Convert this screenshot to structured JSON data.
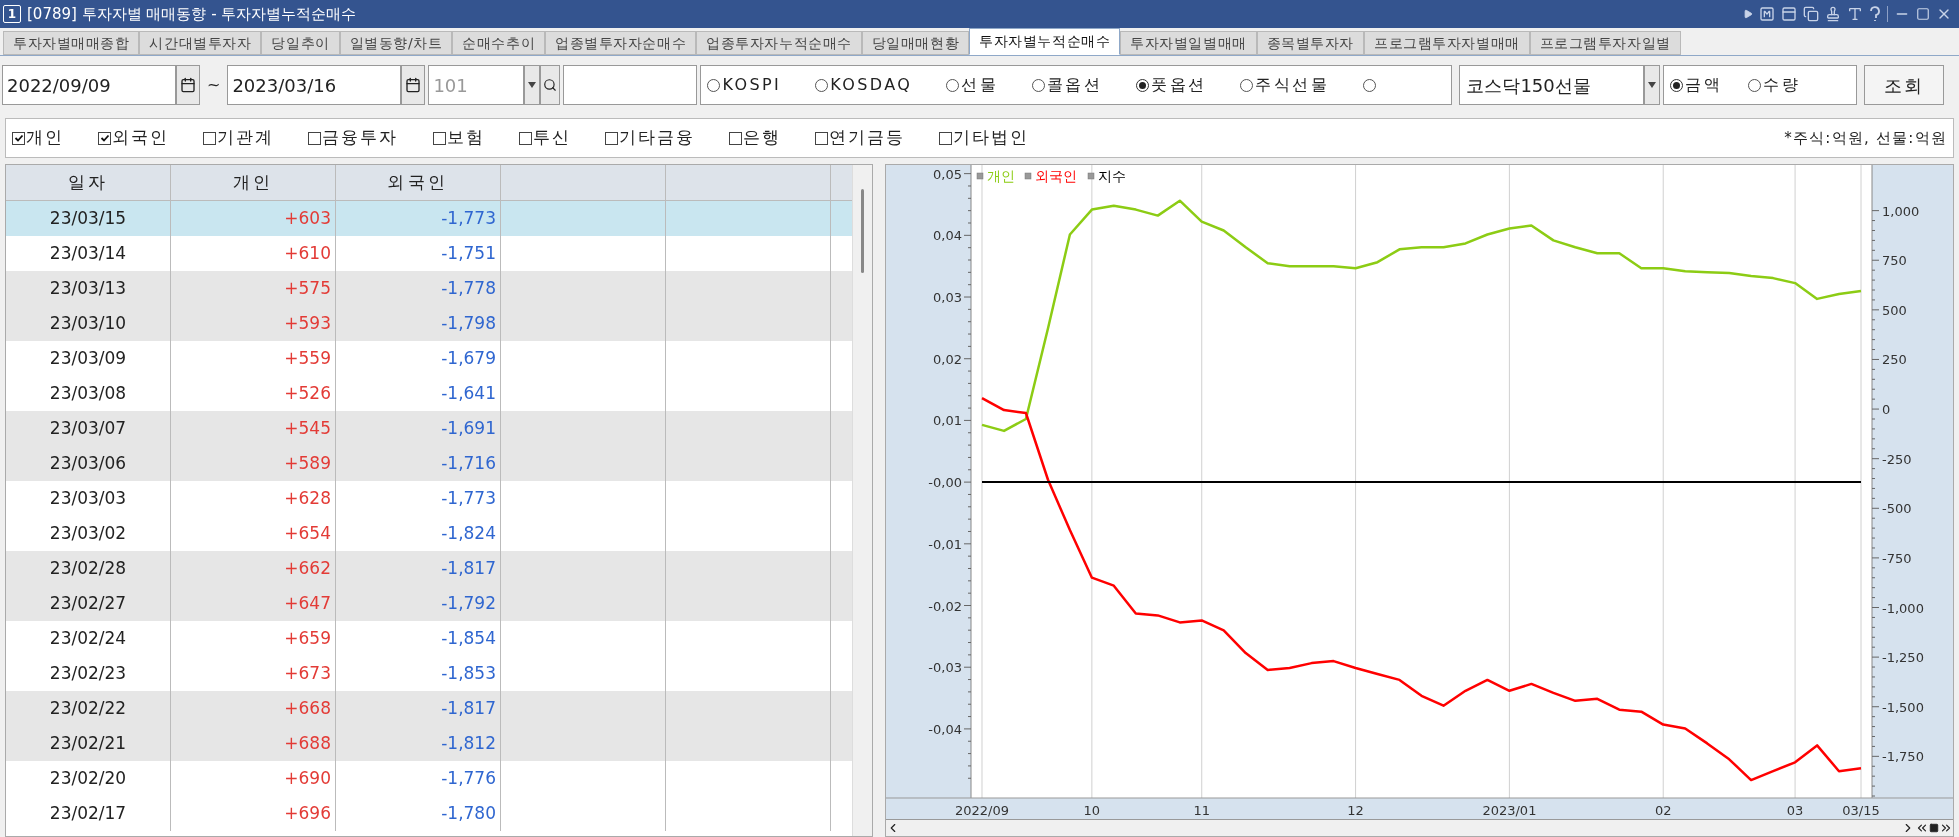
{
  "window": {
    "badge": "1",
    "title": "[0789] 투자자별 매매동향 - 투자자별누적순매수"
  },
  "tabs": [
    {
      "label": "투자자별매매종합",
      "selected": false
    },
    {
      "label": "시간대별투자자",
      "selected": false
    },
    {
      "label": "당일추이",
      "selected": false
    },
    {
      "label": "일별동향/차트",
      "selected": false
    },
    {
      "label": "순매수추이",
      "selected": false
    },
    {
      "label": "업종별투자자순매수",
      "selected": false
    },
    {
      "label": "업종투자자누적순매수",
      "selected": false
    },
    {
      "label": "당일매매현황",
      "selected": false
    },
    {
      "label": "투자자별누적순매수",
      "selected": true
    },
    {
      "label": "투자자별일별매매",
      "selected": false
    },
    {
      "label": "종목별투자자",
      "selected": false
    },
    {
      "label": "프로그램투자자별매매",
      "selected": false
    },
    {
      "label": "프로그램투자자일별",
      "selected": false
    }
  ],
  "query": {
    "start_date": "2022/09/09",
    "separator": "~",
    "end_date": "2023/03/16",
    "code": "101",
    "code_disabled": true,
    "markets": [
      {
        "label": "KOSPI",
        "selected": false
      },
      {
        "label": "KOSDAQ",
        "selected": false
      },
      {
        "label": "선물",
        "selected": false
      },
      {
        "label": "콜옵션",
        "selected": false
      },
      {
        "label": "풋옵션",
        "selected": true
      },
      {
        "label": "주식선물",
        "selected": false
      },
      {
        "selected": false
      }
    ],
    "product": "코스닥150선물",
    "units": [
      {
        "label": "금액",
        "selected": true
      },
      {
        "label": "수량",
        "selected": false
      }
    ],
    "submit": "조회"
  },
  "investors": [
    {
      "label": "개인",
      "checked": true
    },
    {
      "label": "외국인",
      "checked": true
    },
    {
      "label": "기관계",
      "checked": false
    },
    {
      "label": "금융투자",
      "checked": false
    },
    {
      "label": "보험",
      "checked": false
    },
    {
      "label": "투신",
      "checked": false
    },
    {
      "label": "기타금융",
      "checked": false
    },
    {
      "label": "은행",
      "checked": false
    },
    {
      "label": "연기금등",
      "checked": false
    },
    {
      "label": "기타법인",
      "checked": false
    }
  ],
  "unit_note": "*주식:억원, 선물:억원",
  "table": {
    "columns": [
      "일자",
      "개인",
      "외국인"
    ],
    "rows": [
      {
        "cells": [
          "23/03/15",
          "+603",
          "-1,773"
        ],
        "selected": true
      },
      {
        "cells": [
          "23/03/14",
          "+610",
          "-1,751"
        ],
        "selected": false
      },
      {
        "cells": [
          "23/03/13",
          "+575",
          "-1,778"
        ],
        "selected": false
      },
      {
        "cells": [
          "23/03/10",
          "+593",
          "-1,798"
        ],
        "selected": false
      },
      {
        "cells": [
          "23/03/09",
          "+559",
          "-1,679"
        ],
        "selected": false
      },
      {
        "cells": [
          "23/03/08",
          "+526",
          "-1,641"
        ],
        "selected": false
      },
      {
        "cells": [
          "23/03/07",
          "+545",
          "-1,691"
        ],
        "selected": false
      },
      {
        "cells": [
          "23/03/06",
          "+589",
          "-1,716"
        ],
        "selected": false
      },
      {
        "cells": [
          "23/03/03",
          "+628",
          "-1,773"
        ],
        "selected": false
      },
      {
        "cells": [
          "23/03/02",
          "+654",
          "-1,824"
        ],
        "selected": false
      },
      {
        "cells": [
          "23/02/28",
          "+662",
          "-1,817"
        ],
        "selected": false
      },
      {
        "cells": [
          "23/02/27",
          "+647",
          "-1,792"
        ],
        "selected": false
      },
      {
        "cells": [
          "23/02/24",
          "+659",
          "-1,854"
        ],
        "selected": false
      },
      {
        "cells": [
          "23/02/23",
          "+673",
          "-1,853"
        ],
        "selected": false
      },
      {
        "cells": [
          "23/02/22",
          "+668",
          "-1,817"
        ],
        "selected": false
      },
      {
        "cells": [
          "23/02/21",
          "+688",
          "-1,812"
        ],
        "selected": false
      },
      {
        "cells": [
          "23/02/20",
          "+690",
          "-1,776"
        ],
        "selected": false
      },
      {
        "cells": [
          "23/02/17",
          "+696",
          "-1,780"
        ],
        "selected": false
      }
    ]
  },
  "chart": {
    "chart_data": {
      "type": "line",
      "categories": [
        "2022/09",
        null,
        null,
        null,
        null,
        "10",
        null,
        null,
        null,
        null,
        "11",
        null,
        null,
        null,
        null,
        null,
        null,
        "12",
        null,
        null,
        null,
        null,
        null,
        null,
        "2023/01",
        null,
        null,
        null,
        null,
        null,
        null,
        "02",
        null,
        null,
        null,
        null,
        null,
        "03",
        null,
        null,
        "03/15"
      ],
      "grid": true,
      "ylim": [
        -1960,
        1230
      ],
      "yticks": [
        {
          "value": 1000,
          "label": "1,000"
        },
        750,
        500,
        250,
        0,
        -250,
        -500,
        -750,
        {
          "value": -1000,
          "label": "-1,000"
        },
        {
          "value": -1250,
          "label": "-1,250"
        },
        {
          "value": -1500,
          "label": "-1,500"
        },
        {
          "value": -1750,
          "label": "-1,750"
        }
      ],
      "y2lim": [
        -0.0512,
        0.0514
      ],
      "y2ticks": [
        {
          "value": 0.05,
          "label": "0,05"
        },
        {
          "value": 0.04,
          "label": "0,04"
        },
        {
          "value": 0.03,
          "label": "0,03"
        },
        {
          "value": 0.02,
          "label": "0,02"
        },
        {
          "value": 0.01,
          "label": "0,01"
        },
        {
          "value": 0,
          "label": "-0,00"
        },
        {
          "value": -0.01,
          "label": "-0,01"
        },
        {
          "value": -0.02,
          "label": "-0,02"
        },
        {
          "value": -0.03,
          "label": "-0,03"
        },
        {
          "value": -0.04,
          "label": "-0,04"
        }
      ],
      "series": [
        {
          "name": "개인",
          "color": "#8ccc14",
          "values": [
            -80,
            -110,
            -50,
            405,
            880,
            1005,
            1025,
            1005,
            975,
            1050,
            945,
            900,
            815,
            735,
            720,
            720,
            720,
            710,
            740,
            805,
            815,
            815,
            835,
            880,
            910,
            925,
            850,
            815,
            785,
            785,
            710,
            710,
            695,
            690,
            685,
            670,
            660,
            635,
            555,
            580,
            595
          ]
        },
        {
          "name": "외국인",
          "color": "#ff0000",
          "values": [
            55,
            -5,
            -20,
            -355,
            -610,
            -850,
            -890,
            -1030,
            -1040,
            -1075,
            -1065,
            -1115,
            -1230,
            -1315,
            -1305,
            -1280,
            -1270,
            -1305,
            -1335,
            -1365,
            -1445,
            -1495,
            -1420,
            -1365,
            -1420,
            -1385,
            -1430,
            -1470,
            -1460,
            -1515,
            -1525,
            -1590,
            -1610,
            -1685,
            -1765,
            -1870,
            -1825,
            -1780,
            -1695,
            -1825,
            -1810
          ]
        },
        {
          "name": "지수",
          "color": "#000000",
          "axis": "y2",
          "values": [
            0,
            0,
            0,
            0,
            0,
            0,
            0,
            0,
            0,
            0,
            0,
            0,
            0,
            0,
            0,
            0,
            0,
            0,
            0,
            0,
            0,
            0,
            0,
            0,
            0,
            0,
            0,
            0,
            0,
            0,
            0,
            0,
            0,
            0,
            0,
            0,
            0,
            0,
            0,
            0,
            0
          ]
        }
      ]
    }
  }
}
